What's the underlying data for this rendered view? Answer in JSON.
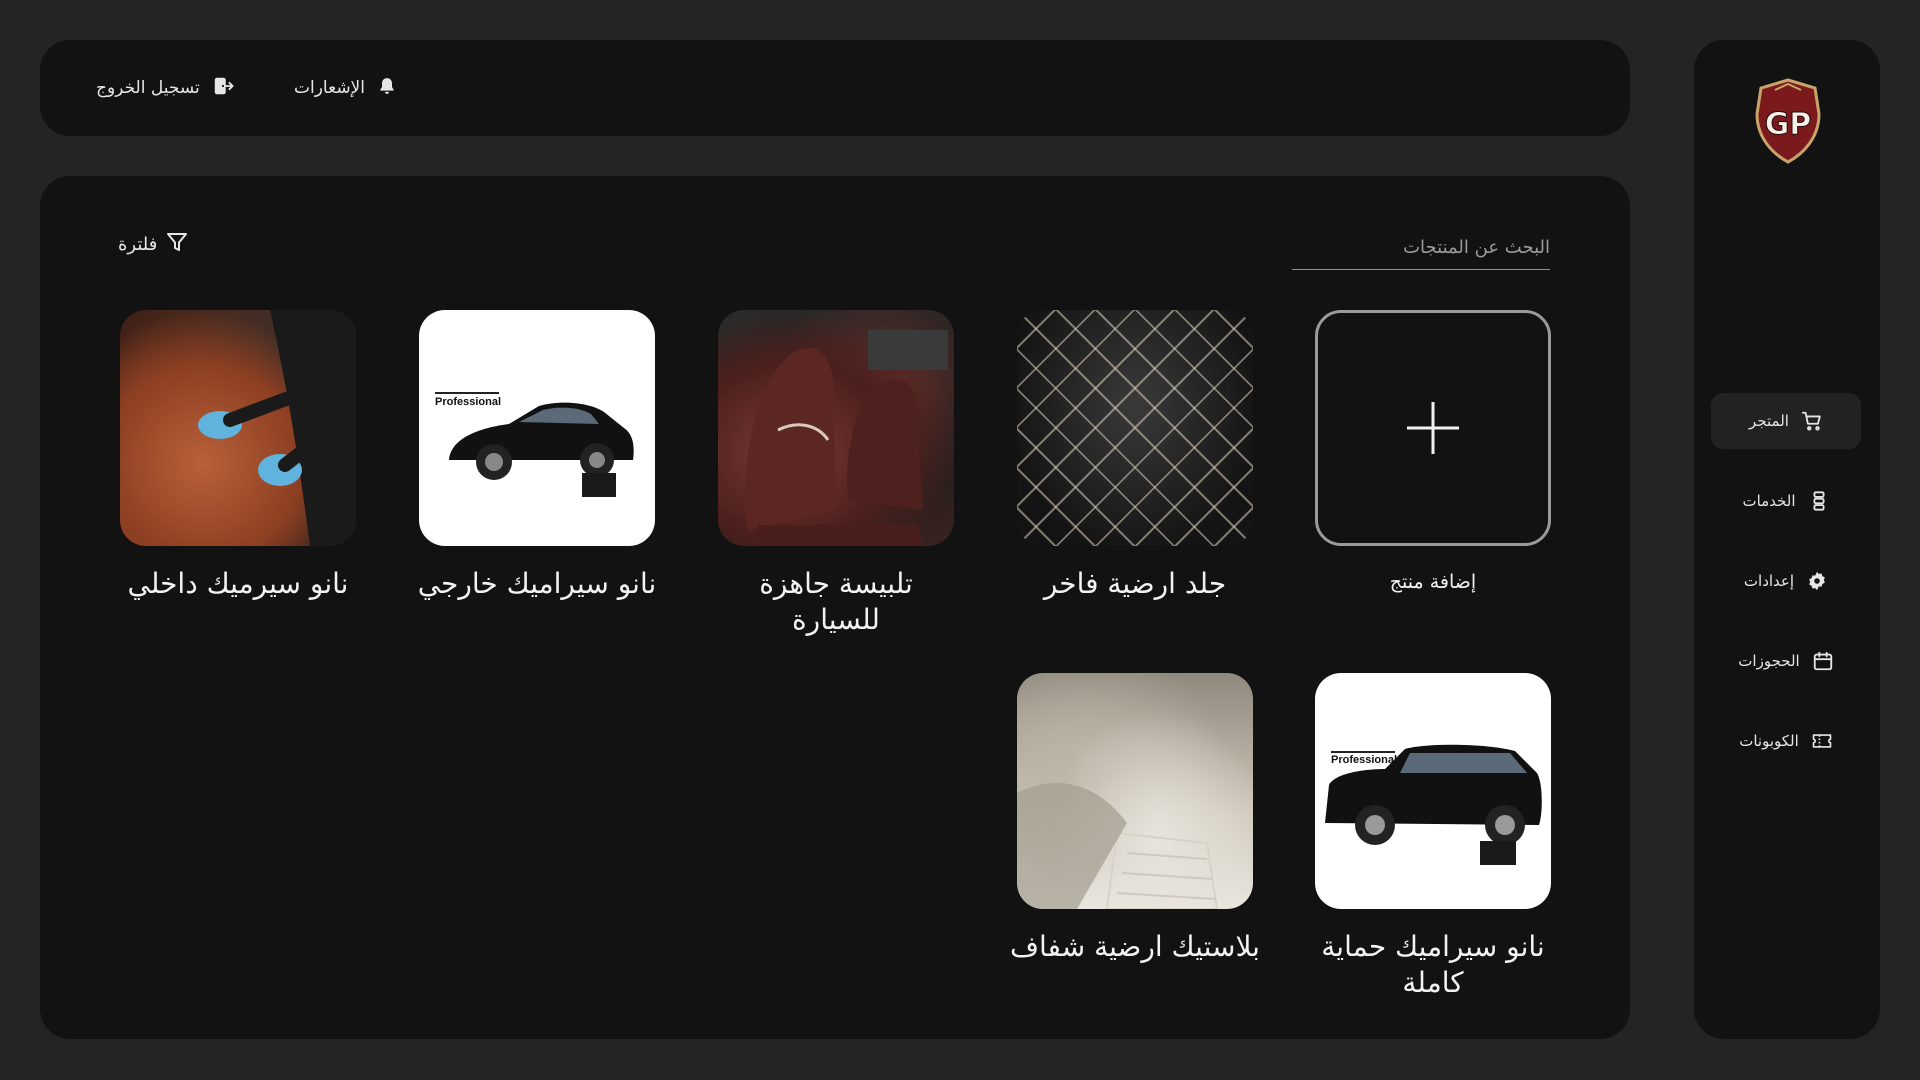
{
  "topbar": {
    "logout_label": "تسجيل الخروج",
    "notifications_label": "الإشعارات"
  },
  "sidebar": {
    "logo_text": "GP",
    "items": [
      {
        "label": "المتجر",
        "icon": "cart-icon",
        "active": true
      },
      {
        "label": "الخدمات",
        "icon": "server-stack-icon",
        "active": false
      },
      {
        "label": "إعدادات",
        "icon": "gear-icon",
        "active": false
      },
      {
        "label": "الحجوزات",
        "icon": "calendar-icon",
        "active": false
      },
      {
        "label": "الكوبونات",
        "icon": "ticket-icon",
        "active": false
      }
    ]
  },
  "main": {
    "search": {
      "placeholder": "البحث عن المنتجات",
      "value": ""
    },
    "filter_label": "فلترة",
    "add_product_label": "إضافة منتج",
    "products": [
      {
        "title": "جلد ارضية فاخر",
        "image": "leather-floor-mat"
      },
      {
        "title": "تلبيسة جاهزة للسيارة",
        "image": "seat-covers"
      },
      {
        "title": "نانو سيراميك خارجي",
        "image": "exterior-car-ceramic",
        "brand": "Professional"
      },
      {
        "title": "نانو سيرميك داخلي",
        "image": "interior-leather-ceramic"
      },
      {
        "title": "نانو سيراميك حماية كاملة",
        "image": "full-protection-suv",
        "brand": "Professional"
      },
      {
        "title": "بلاستيك ارضية شفاف",
        "image": "clear-plastic-floor"
      }
    ]
  },
  "colors": {
    "background": "#242424",
    "panel": "#121212",
    "active_nav": "#222222",
    "logo_red": "#7a1a1c",
    "logo_gold": "#c8a46a"
  }
}
